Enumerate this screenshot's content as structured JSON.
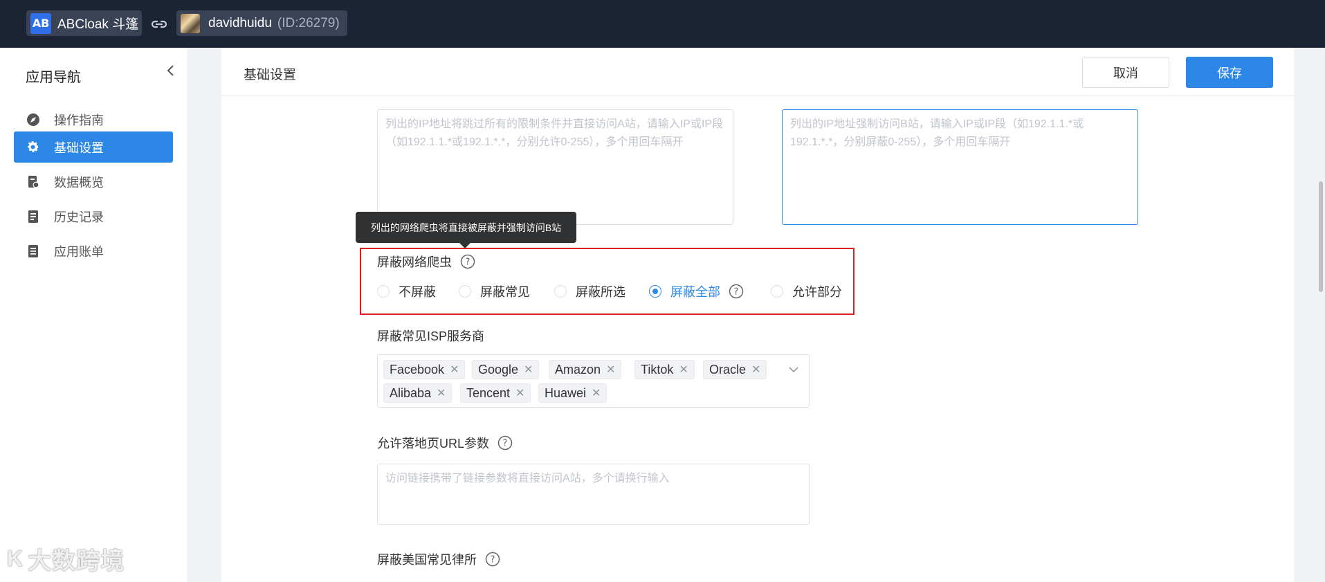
{
  "topbar": {
    "app_logo": "AB",
    "app_name": "ABCloak 斗篷",
    "link_icon": "link-icon",
    "user_name": "davidhuidu",
    "user_id": "(ID:26279)"
  },
  "sidebar": {
    "title": "应用导航",
    "items": [
      {
        "label": "操作指南",
        "icon": "compass-icon"
      },
      {
        "label": "基础设置",
        "icon": "gear-icon"
      },
      {
        "label": "数据概览",
        "icon": "chart-icon"
      },
      {
        "label": "历史记录",
        "icon": "document-icon"
      },
      {
        "label": "应用账单",
        "icon": "bill-icon"
      }
    ],
    "active_index": 1
  },
  "watermark": {
    "mark": "K",
    "text": "大数跨境"
  },
  "main": {
    "title": "基础设置",
    "cancel_label": "取消",
    "save_label": "保存",
    "whitelist_placeholder": "列出的IP地址将跳过所有的限制条件并直接访问A站，请输入IP或IP段（如192.1.1.*或192.1.*.*，分别允许0-255），多个用回车隔开",
    "blacklist_placeholder": "列出的IP地址强制访问B站，请输入IP或IP段（如192.1.1.*或192.1.*.*，分别屏蔽0-255），多个用回车隔开",
    "tooltip": "列出的网络爬虫将直接被屏蔽并强制访问B站",
    "crawler": {
      "label": "屏蔽网络爬虫",
      "options": [
        "不屏蔽",
        "屏蔽常见",
        "屏蔽所选",
        "屏蔽全部",
        "允许部分"
      ],
      "selected": "屏蔽全部"
    },
    "isp": {
      "label": "屏蔽常见ISP服务商",
      "tags": [
        "Facebook",
        "Google",
        "Amazon",
        "Tiktok",
        "Oracle",
        "Alibaba",
        "Tencent",
        "Huawei"
      ]
    },
    "url_params": {
      "label": "允许落地页URL参数",
      "placeholder": "访问链接携带了链接参数将直接访问A站，多个请换行输入"
    },
    "law_firms": {
      "label": "屏蔽美国常见律所"
    }
  },
  "colors": {
    "accent": "#2d87e6",
    "topbar": "#1b2335",
    "highlight": "#e02020"
  }
}
